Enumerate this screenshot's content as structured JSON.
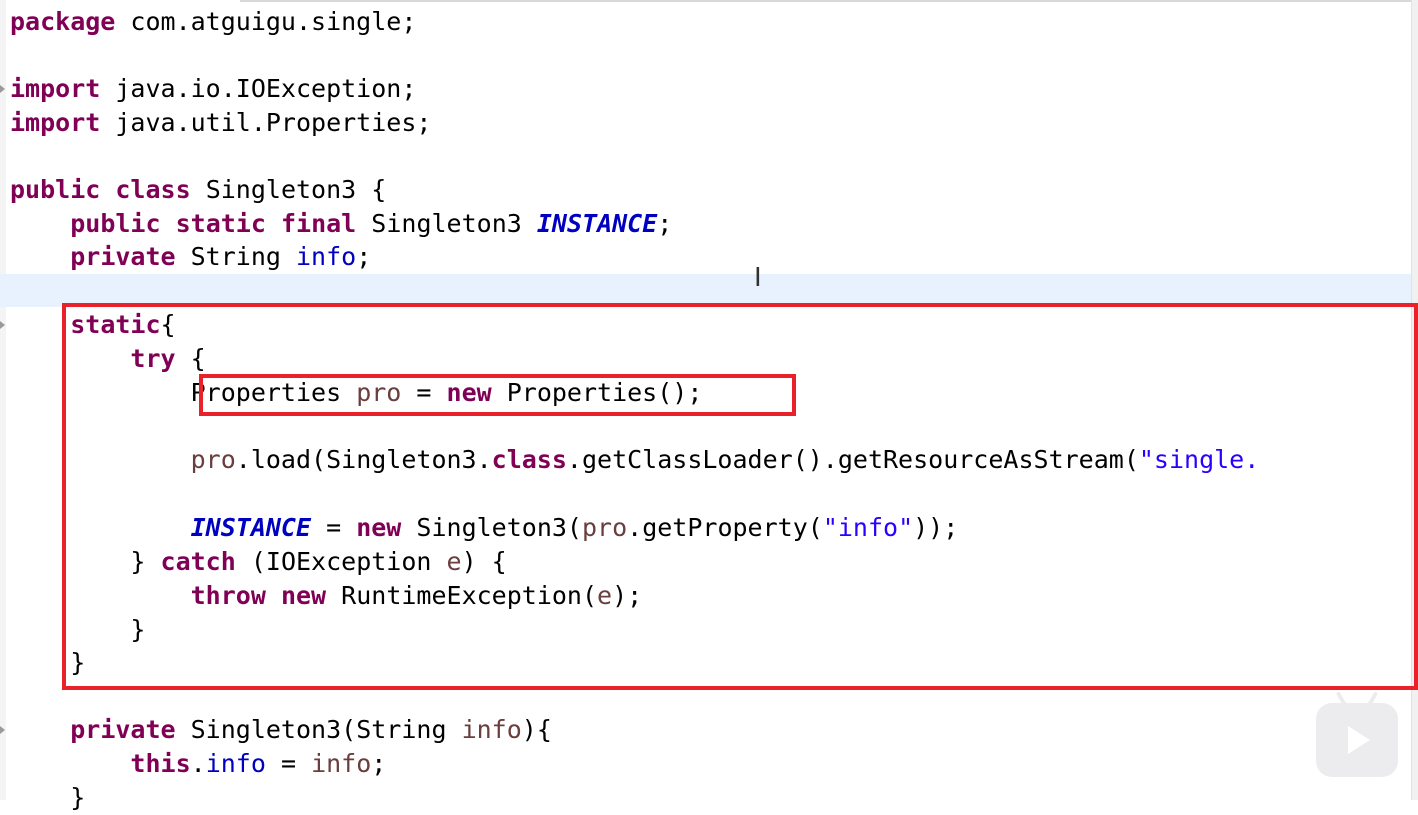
{
  "editor": {
    "lines": {
      "l1": {
        "kw": "package",
        "rest": " com.atguigu.single;"
      },
      "l3": {
        "kw": "import",
        "rest": " java.io.IOException;"
      },
      "l4": {
        "kw": "import",
        "rest": " java.util.Properties;"
      },
      "l6": {
        "kw1": "public",
        "kw2": "class",
        "rest": " Singleton3 {"
      },
      "l7": {
        "kw1": "public",
        "kw2": "static",
        "kw3": "final",
        "type": " Singleton3 ",
        "field": "INSTANCE",
        "end": ";"
      },
      "l8": {
        "kw": "private",
        "type": " String ",
        "field": "info",
        "end": ";"
      },
      "l10": {
        "kw": "static",
        "end": "{"
      },
      "l11": {
        "kw": "try",
        "end": " {"
      },
      "l12": {
        "a": "Properties ",
        "var": "pro",
        "b": " = ",
        "kw": "new",
        "c": " Properties();"
      },
      "l14": {
        "var": "pro",
        "a": ".load(Singleton3.",
        "kw": "class",
        "b": ".getClassLoader().getResourceAsStream(",
        "str": "\"single."
      },
      "l16": {
        "field": "INSTANCE",
        "a": " = ",
        "kw": "new",
        "b": " Singleton3(",
        "var": "pro",
        "c": ".getProperty(",
        "str": "\"info\"",
        "d": "));"
      },
      "l17": {
        "a": "} ",
        "kw": "catch",
        "b": " (IOException ",
        "var": "e",
        "c": ") {"
      },
      "l18": {
        "kw1": "throw",
        "kw2": "new",
        "a": " RuntimeException(",
        "var": "e",
        "b": ");"
      },
      "l19": {
        "a": "}"
      },
      "l20": {
        "a": "}"
      },
      "l22": {
        "kw": "private",
        "a": " Singleton3(String ",
        "var": "info",
        "b": "){"
      },
      "l23": {
        "kw": "this",
        "a": ".",
        "field": "info",
        "b": " = ",
        "var": "info",
        "c": ";"
      },
      "l24": {
        "a": "}"
      }
    }
  },
  "colors": {
    "keyword": "#7f0055",
    "field": "#0000c0",
    "local_variable": "#6a3e3e",
    "string": "#2a00ff",
    "highlight_box": "#e8212a",
    "current_line": "#e8f2fe"
  },
  "overlay": {
    "play_icon": "play-icon",
    "cursor_icon": "text-cursor-icon"
  }
}
